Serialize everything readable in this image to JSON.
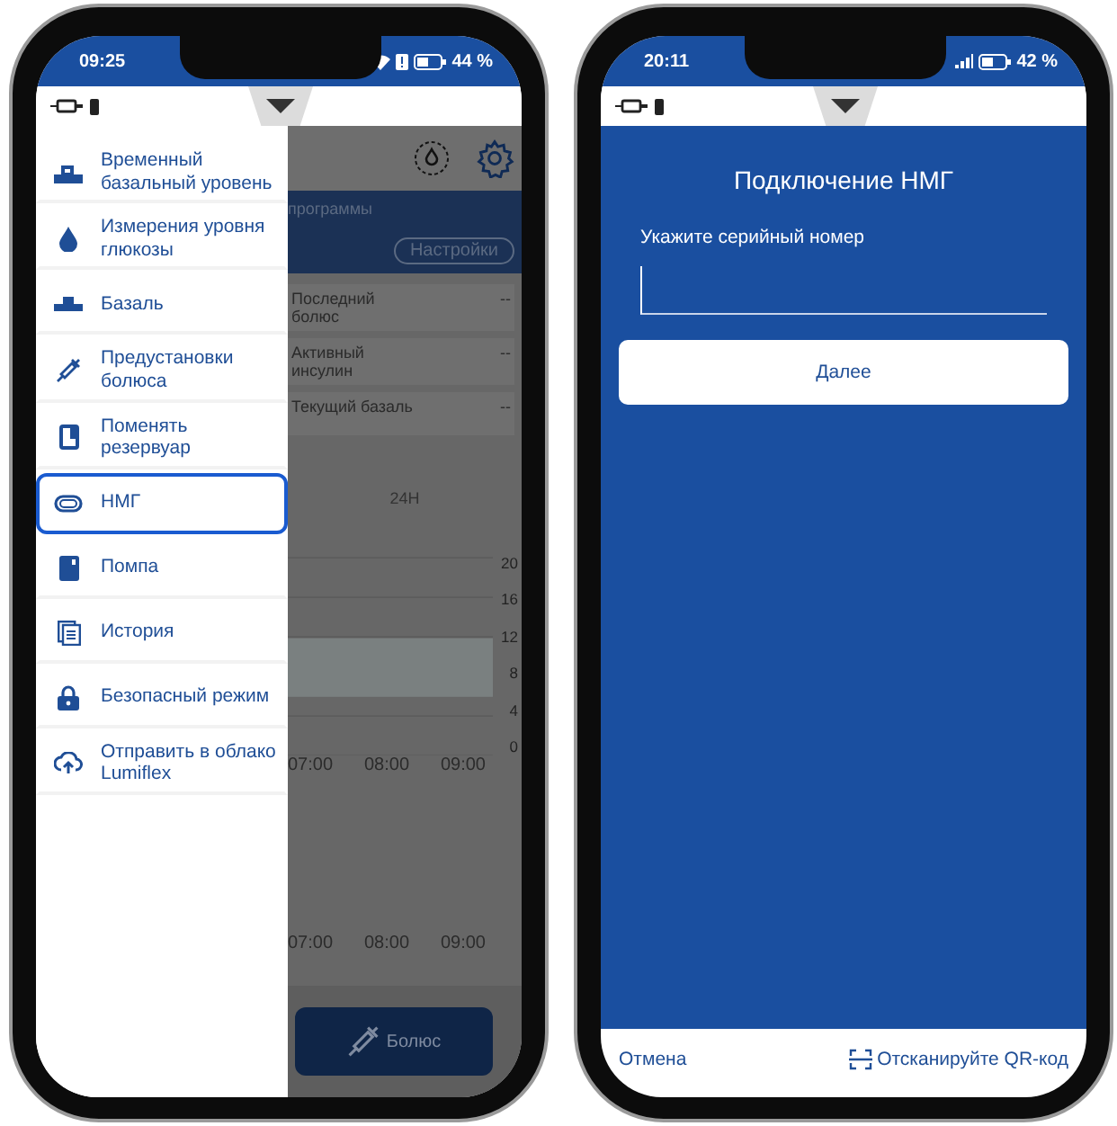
{
  "left_phone": {
    "status_bar": {
      "time": "09:25",
      "battery": "44 %"
    },
    "drawer": {
      "items": [
        {
          "kind": "temp-basal",
          "label": "Временный базальный уровень",
          "selected": false
        },
        {
          "kind": "drop",
          "label": "Измерения уровня глюкозы",
          "selected": false
        },
        {
          "kind": "basal",
          "label": "Базаль",
          "selected": false
        },
        {
          "kind": "syringe",
          "label": "Предустановки болюса",
          "selected": false
        },
        {
          "kind": "reservoir",
          "label": "Поменять резервуар",
          "selected": false
        },
        {
          "kind": "sensor",
          "label": "НМГ",
          "selected": true
        },
        {
          "kind": "pump",
          "label": "Помпа",
          "selected": false
        },
        {
          "kind": "history",
          "label": "История",
          "selected": false
        },
        {
          "kind": "lock",
          "label": "Безопасный режим",
          "selected": false
        },
        {
          "kind": "cloud",
          "label": "Отправить в облако Lumiflex",
          "selected": false
        }
      ]
    },
    "background": {
      "banner_text": "программы",
      "settings_button": "Настройки",
      "info_rows": [
        {
          "label": "Последний болюс",
          "value": "--"
        },
        {
          "label": "Активный инсулин",
          "value": "--"
        },
        {
          "label": "Текущий базаль",
          "value": "--"
        }
      ],
      "range_label": "24H",
      "chart_yticks": [
        "20",
        "16",
        "12",
        "8",
        "4",
        "0"
      ],
      "chart_xlabels": [
        "07:00",
        "08:00",
        "09:00"
      ],
      "second_xlabels": [
        "07:00",
        "08:00",
        "09:00"
      ],
      "bolus_button": "Болюс"
    }
  },
  "right_phone": {
    "status_bar": {
      "time": "20:11",
      "battery": "42 %"
    },
    "title": "Подключение НМГ",
    "serial_label": "Укажите серийный номер",
    "next_button": "Далее",
    "cancel_link": "Отмена",
    "scan_link": "Отсканируйте QR-код"
  }
}
